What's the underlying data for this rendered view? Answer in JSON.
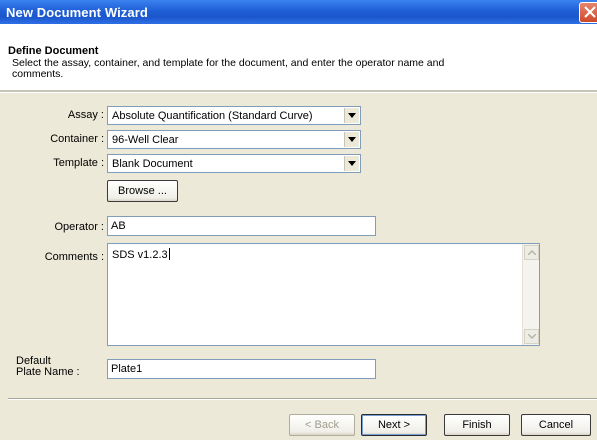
{
  "window": {
    "title": "New Document Wizard"
  },
  "header": {
    "title": "Define Document",
    "description": "Select the assay, container, and template for the document, and enter the operator name and comments."
  },
  "form": {
    "assay": {
      "label": "Assay :",
      "value": "Absolute Quantification (Standard Curve)"
    },
    "container": {
      "label": "Container :",
      "value": "96-Well Clear"
    },
    "template": {
      "label": "Template :",
      "value": "Blank Document"
    },
    "browse_label": "Browse ...",
    "operator": {
      "label": "Operator :",
      "value": "AB"
    },
    "comments": {
      "label": "Comments :",
      "value": "SDS v1.2.3"
    },
    "plate_name": {
      "label_line1": "Default",
      "label_line2": "Plate Name :",
      "value": "Plate1"
    }
  },
  "footer": {
    "back_label": "< Back",
    "next_label": "Next >",
    "finish_label": "Finish",
    "cancel_label": "Cancel"
  }
}
